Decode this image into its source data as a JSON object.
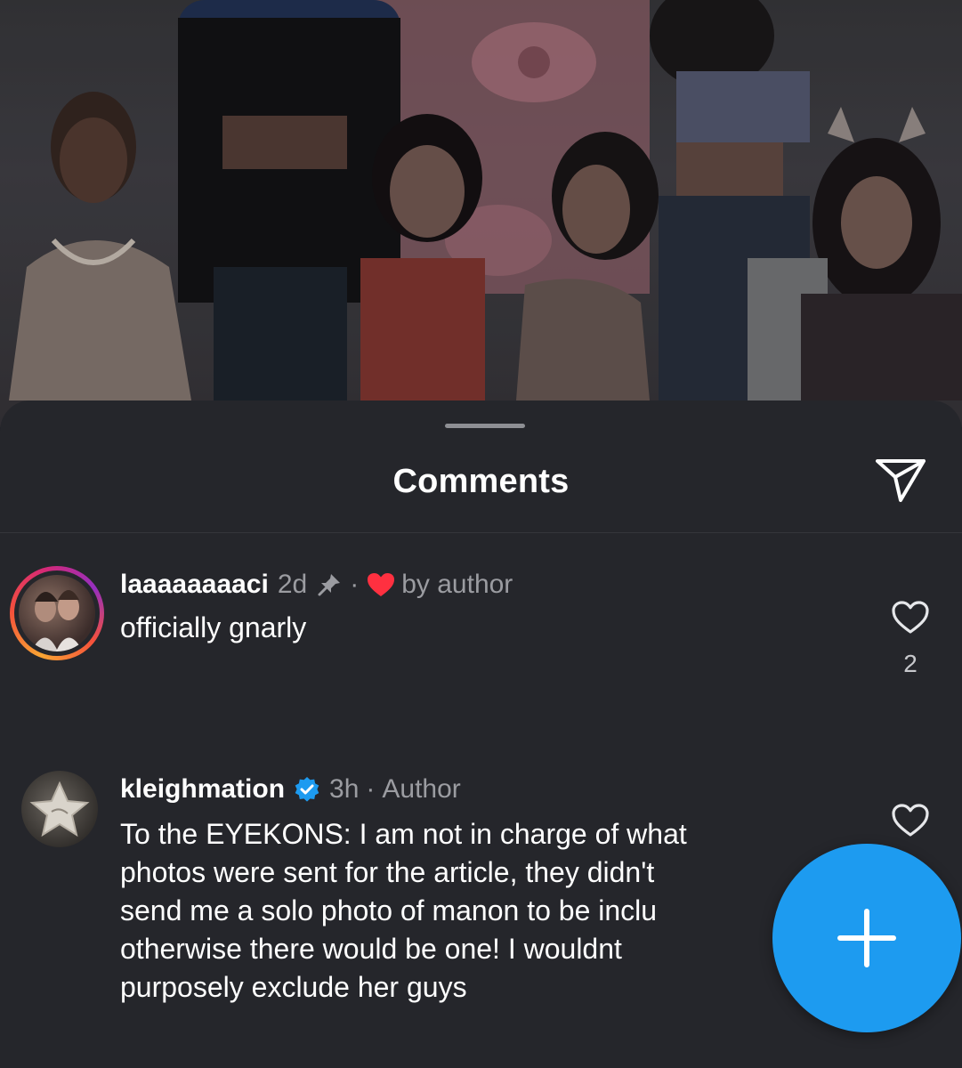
{
  "sheet": {
    "title": "Comments",
    "share_icon": "send-icon"
  },
  "comments": [
    {
      "username": "laaaaaaaaci",
      "time": "2d",
      "pinned": true,
      "pin_icon": "pin-icon",
      "liked_by_author_label": "by author",
      "heart_icon": "heart-filled-icon",
      "text": "officially gnarly",
      "like_icon": "heart-outline-icon",
      "like_count": "2"
    },
    {
      "username": "kleighmation",
      "verified_icon": "verified-badge-icon",
      "time": "3h",
      "author_label": "Author",
      "text_lines": [
        "To the EYEKONS: I am not in charge of what",
        "photos were sent for the article, they didn't",
        "send me a solo photo of manon to be inclu",
        "otherwise there would be one! I wouldnt",
        "purposely exclude her guys"
      ],
      "like_icon": "heart-outline-icon"
    }
  ],
  "fab": {
    "icon": "plus-icon",
    "color": "#1d9bf0"
  },
  "colors": {
    "sheet_bg": "#25262b",
    "heart_red": "#ff3040",
    "verified_blue": "#1d9bf0"
  }
}
